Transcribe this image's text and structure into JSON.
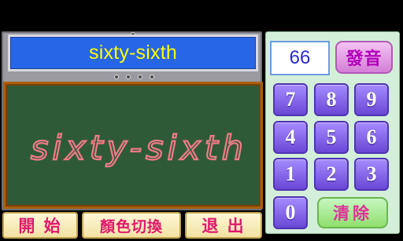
{
  "title": {
    "word": "sixty-sixth"
  },
  "chalkboard": {
    "handwriting": "sixty-sixth",
    "chalk_color": "#f07a86"
  },
  "keypad": {
    "display_value": "66",
    "speak_label": "發音",
    "digits": [
      "7",
      "8",
      "9",
      "4",
      "5",
      "6",
      "1",
      "2",
      "3",
      "0"
    ],
    "clear_label": "清除"
  },
  "bottom_bar": {
    "start_label": "開 始",
    "color_switch_label": "顏色切換",
    "exit_label": "退 出"
  },
  "colors": {
    "banner": "#2766e6",
    "banner_text": "#ffff00",
    "board": "#2f5a38",
    "board_frame": "#a8600e",
    "keypad_bg": "#d4efd9",
    "digit_key": "#7f62ea",
    "speak_key": "#e3a0e5",
    "clear_key": "#a8e88c",
    "bottom_text": "#e0186e"
  }
}
